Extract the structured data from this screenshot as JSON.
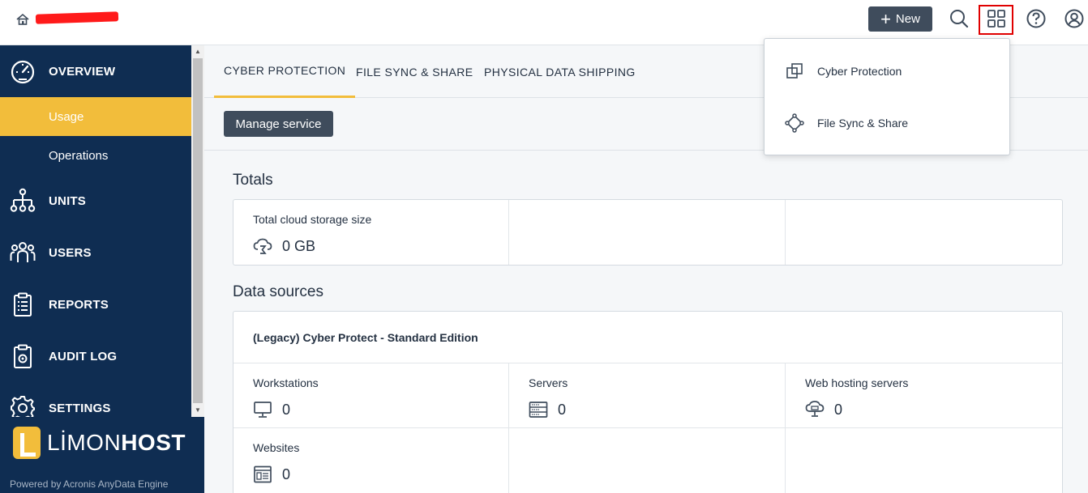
{
  "header": {
    "new_label": "New",
    "plus_glyph": "+"
  },
  "sidebar": {
    "items": [
      {
        "label": "OVERVIEW",
        "icon": "gauge-icon"
      },
      {
        "label": "Usage",
        "active": true
      },
      {
        "label": "Operations"
      },
      {
        "label": "UNITS",
        "icon": "hierarchy-icon"
      },
      {
        "label": "USERS",
        "icon": "users-icon"
      },
      {
        "label": "REPORTS",
        "icon": "clipboard-icon"
      },
      {
        "label": "AUDIT LOG",
        "icon": "audit-log-icon"
      },
      {
        "label": "SETTINGS",
        "icon": "gear-icon"
      }
    ],
    "logo_prefix": "LİMON",
    "logo_suffix": "HOST",
    "powered_by": "Powered by Acronis AnyData Engine"
  },
  "tabs": [
    {
      "label": "CYBER PROTECTION",
      "active": true
    },
    {
      "label": "FILE SYNC & SHARE"
    },
    {
      "label": "PHYSICAL DATA SHIPPING"
    }
  ],
  "actions": {
    "manage_service": "Manage service"
  },
  "totals": {
    "title": "Totals",
    "storage_label": "Total cloud storage size",
    "storage_value": "0 GB"
  },
  "data_sources": {
    "title": "Data sources",
    "edition": "(Legacy) Cyber Protect - Standard Edition",
    "items": [
      {
        "label": "Workstations",
        "value": "0",
        "icon": "monitor-icon"
      },
      {
        "label": "Servers",
        "value": "0",
        "icon": "server-icon"
      },
      {
        "label": "Web hosting servers",
        "value": "0",
        "icon": "cloud-server-icon"
      },
      {
        "label": "Websites",
        "value": "0",
        "icon": "website-icon"
      }
    ]
  },
  "dropdown": {
    "items": [
      {
        "label": "Cyber Protection",
        "icon": "cyber-protection-icon"
      },
      {
        "label": "File Sync & Share",
        "icon": "file-sync-icon"
      }
    ]
  },
  "colors": {
    "sidebar_bg": "#0f2d52",
    "accent": "#f2bd3b",
    "button_bg": "#3f4c5c",
    "highlight_border": "#e00000"
  }
}
